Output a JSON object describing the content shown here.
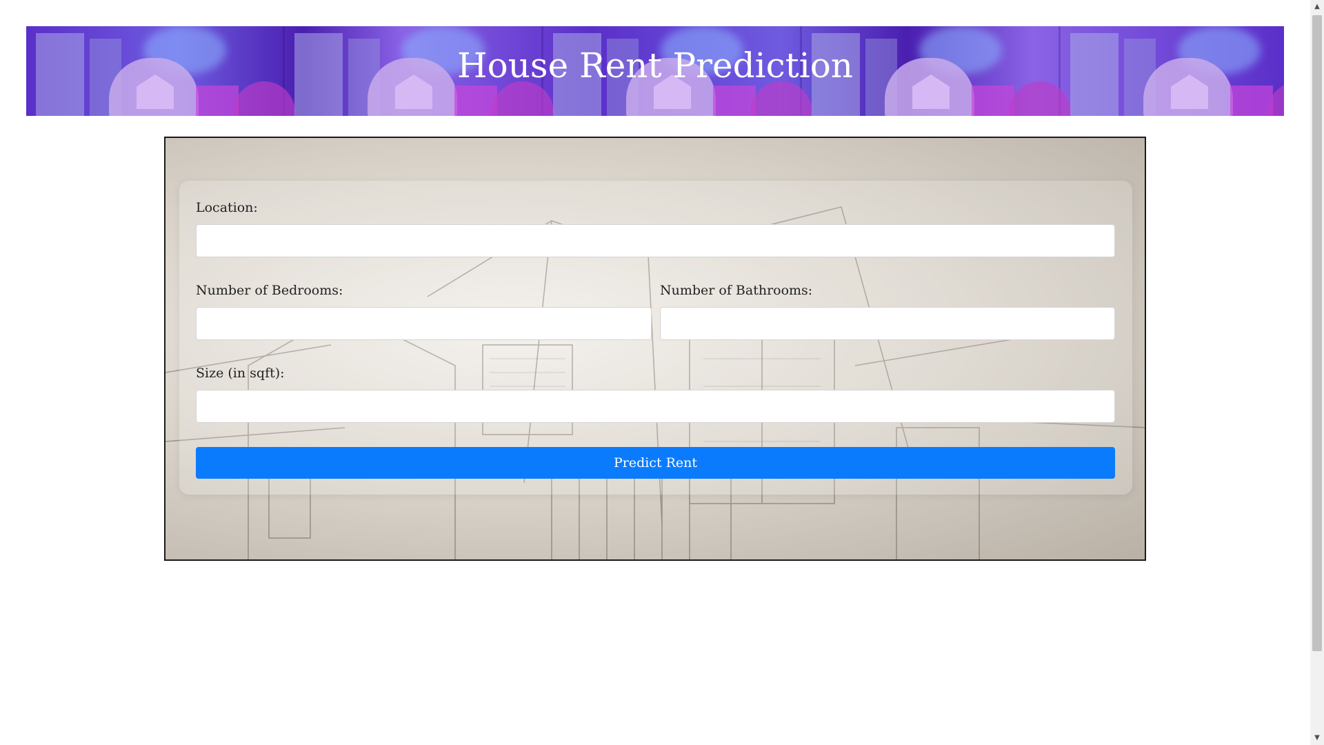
{
  "header": {
    "title": "House Rent Prediction"
  },
  "form": {
    "location_label": "Location:",
    "location_value": "",
    "bedrooms_label": "Number of Bedrooms:",
    "bedrooms_value": "",
    "bathrooms_label": "Number of Bathrooms:",
    "bathrooms_value": "",
    "size_label": "Size (in sqft):",
    "size_value": "",
    "submit_label": "Predict Rent"
  },
  "colors": {
    "button": "#0a7bfd",
    "banner": "#5a2fc9"
  },
  "scrollbar": {
    "up_icon": "scroll-up-arrow-icon",
    "down_icon": "scroll-down-arrow-icon"
  }
}
